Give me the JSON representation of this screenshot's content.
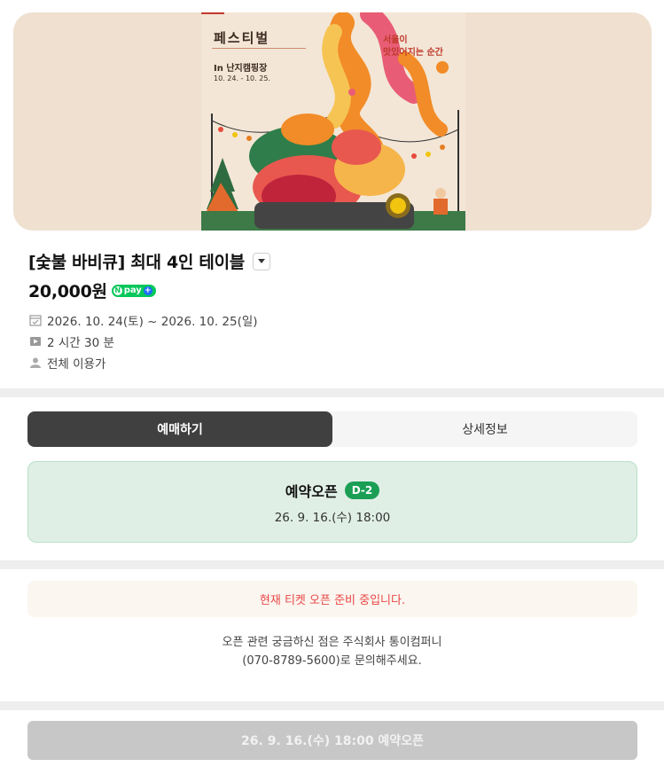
{
  "poster": {
    "title_line": "페스티벌",
    "venue": "In 난지캠핑장",
    "dates": "10. 24. - 10. 25.",
    "tagline_line1": "서울이",
    "tagline_line2": "맛있어지는 순간"
  },
  "product": {
    "title": "[숯불 바비큐] 최대 4인 테이블",
    "price": "20,000원",
    "npay_label": "pay",
    "date_range": "2026. 10. 24(토) ~ 2026. 10. 25(일)",
    "duration": "2 시간 30 분",
    "age_rating": "전체 이용가"
  },
  "tabs": [
    {
      "label": "예매하기",
      "active": true
    },
    {
      "label": "상세정보",
      "active": false
    }
  ],
  "reservation": {
    "title": "예약오픈",
    "dday_badge": "D-2",
    "open_datetime": "26. 9. 16.(수) 18:00"
  },
  "notice": {
    "message": "현재 티켓 오픈 준비 중입니다.",
    "contact_line1": "오픈 관련 궁금하신 점은 주식회사 통이컴퍼니",
    "contact_line2": "(070-8789-5600)로 문의해주세요."
  },
  "bottom_button": {
    "label": "26. 9. 16.(수) 18:00 예약오픈"
  },
  "colors": {
    "accent_green": "#1a9f55",
    "notice_red": "#e94545",
    "tab_active": "#404040"
  }
}
